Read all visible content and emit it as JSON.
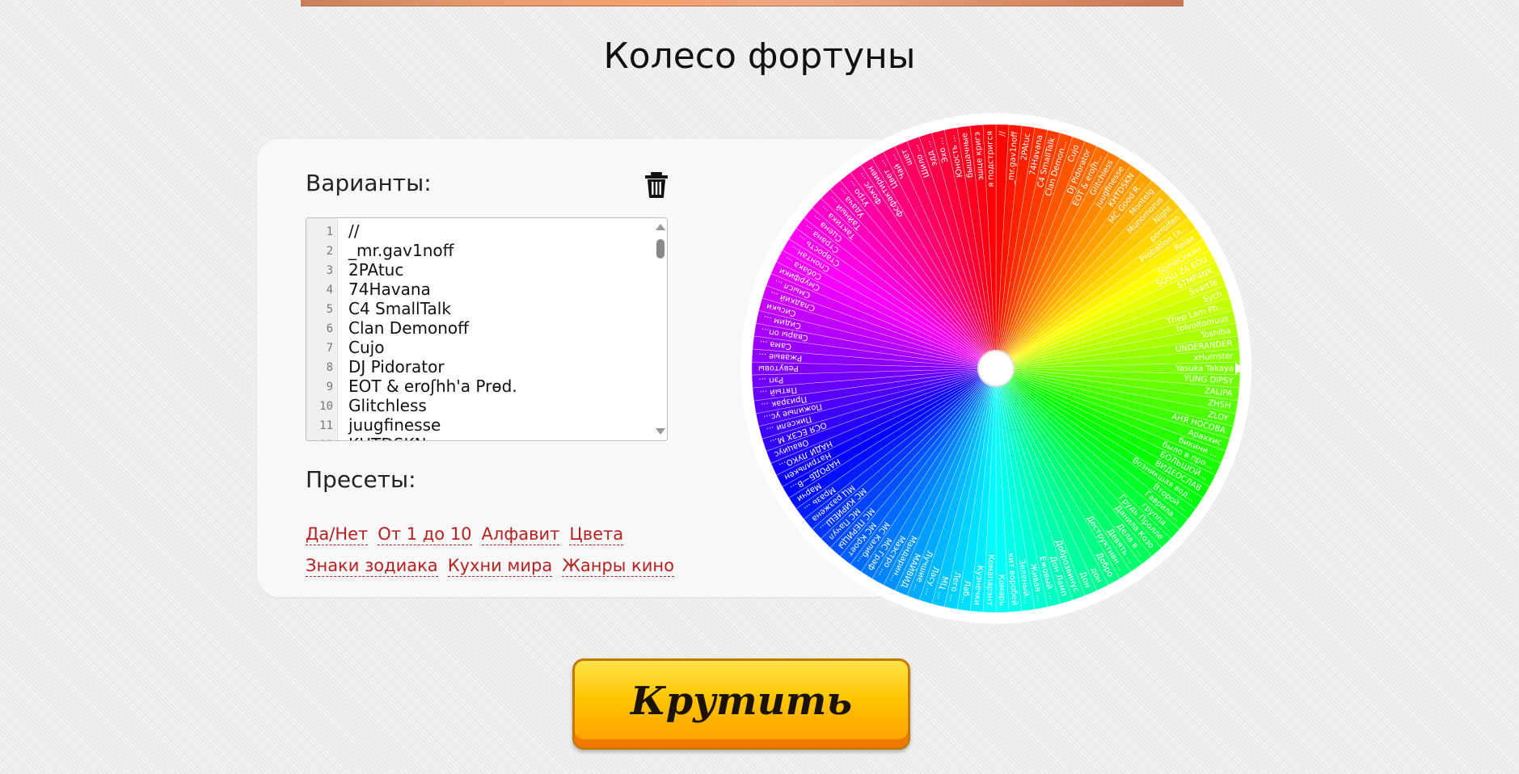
{
  "page": {
    "title": "Колесо фортуны"
  },
  "panel": {
    "variants_label": "Варианты:",
    "presets_label": "Пресеты:"
  },
  "editor": {
    "lines": [
      "//",
      "_mr.gav1noff",
      "2PAtuc",
      "74Havana",
      "C4 SmallTalk",
      "Clan Demonoff",
      "Cujo",
      "DJ Pidorator",
      "EOT & eroʃhh'a Prɵd.",
      "Glitchless",
      "juugfinesse",
      "KHTDSKN"
    ]
  },
  "presets": [
    [
      "Да/Нет",
      "От 1 до 10",
      "Алфавит",
      "Цвета"
    ],
    [
      "Знаки зодиака",
      "Кухни мира",
      "Жанры кино"
    ]
  ],
  "wheel": {
    "labels": [
      "//",
      "_mr.gav1noff",
      "2PAtuc",
      "74Havana",
      "C4 SmallTalk",
      "Clan Demon...",
      "Cujo",
      "DJ Pidorator",
      "EOT & eroʃh...",
      "Glitchless",
      "juugfinesse",
      "KHTDSKN",
      "MC Good R...",
      "Montelg",
      "Munomorus",
      "Night",
      "porrolfen",
      "Probation (л...",
      "Relax",
      "SomeCекин",
      "SOSU ZA EDU",
      "STMP4NK",
      "SvartTe",
      "Sych",
      "Thep Lam Ph...",
      "tolvoltomuus",
      "Toshiba",
      "UNDERANDER",
      "xHumster",
      "Yasuka Takaya",
      "YUNG DIPSY",
      "ZALIPA",
      "ZHSH",
      "ZLOY",
      "АНЯ НОСОВА",
      "Араххис",
      "бикини ...",
      "было в про...",
      "БОЛЬШОЙ...",
      "ВИДЕОСЛАВ",
      "Возникшая вод...",
      "Второй ...",
      "Гаврила...",
      "группа...",
      "Грудь Пролле",
      "Данила Козо",
      "Дела в ...",
      "Девять ...",
      "Деструктивн...",
      "Добро",
      "дон",
      "Дон",
      "Доброзвинус",
      "Дон Ламп",
      "Ежовый ...",
      "Живая ...",
      "Зеленый...",
      "кит воробей",
      "Комарь",
      "Комапарэнт",
      "Кузнечки",
      "Лаб...",
      "Лего ...",
      "МЦ ...",
      "Ласу ...",
      "Лучшие ...",
      "МАЙВИД",
      "Мандарин...",
      "Маэстро ...",
      "МС Граф",
      "МС Калиб...",
      "МС Кроет",
      "МС ПЕРИЦЫ",
      "МС Пачул",
      "МС КИРИЕШ...",
      "МЦ разжена",
      "Мразь ...",
      "Марчи",
      "НАРОДБ—В...",
      "Натрилькен",
      "НАДИ ЛУКО...",
      "Овациус",
      "ОСЯ ЕСЗХ М...",
      "Пиксели ...",
      "Пожилые ус...",
      "Призрак ...",
      "Пятый ...",
      "Рэп ...",
      "Ревутовы",
      "Ржавые ...",
      "Сама ...",
      "Свары оп...",
      "Сидим ...",
      "Сиськи",
      "Сладкий ...",
      "Смысл ...",
      "Смурфики",
      "Собака ...",
      "Спонтан...",
      "Старость ...",
      "Страна ...",
      "Сцена ...",
      "Тактика ...",
      "Тайный ...",
      "Удача ...",
      "Утро ...",
      "Фокус ...",
      "фсфактиривн",
      "Цвет ...",
      "Чай ...",
      "шет",
      "Шило ...",
      "эдд ...",
      "Эхо ...",
      "Юность ...",
      "бышачные",
      "эшце кригэ",
      "я подстригся"
    ]
  },
  "spin_button": {
    "label": "Крутить"
  }
}
